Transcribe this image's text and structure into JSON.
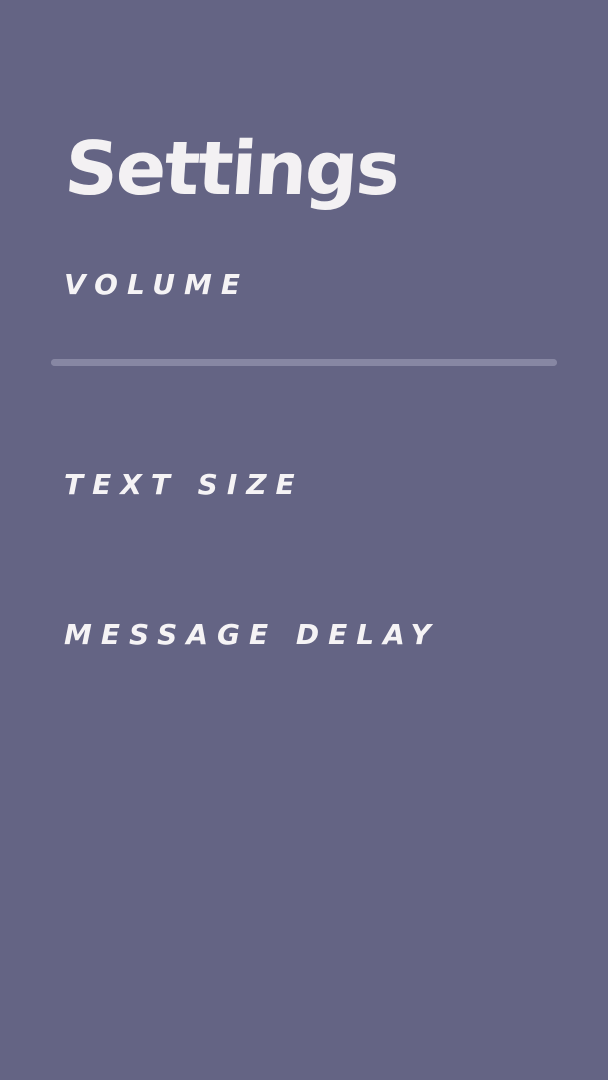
{
  "screen": {
    "background_color": "#646484",
    "text_color": "#f3f1f3"
  },
  "settings": {
    "title": "Settings",
    "volume": {
      "label": "VOLUME",
      "level": 1.0
    },
    "text_size": {
      "label": "TEXT SIZE"
    },
    "message_delay": {
      "label": "MESSAGE DELAY"
    }
  }
}
